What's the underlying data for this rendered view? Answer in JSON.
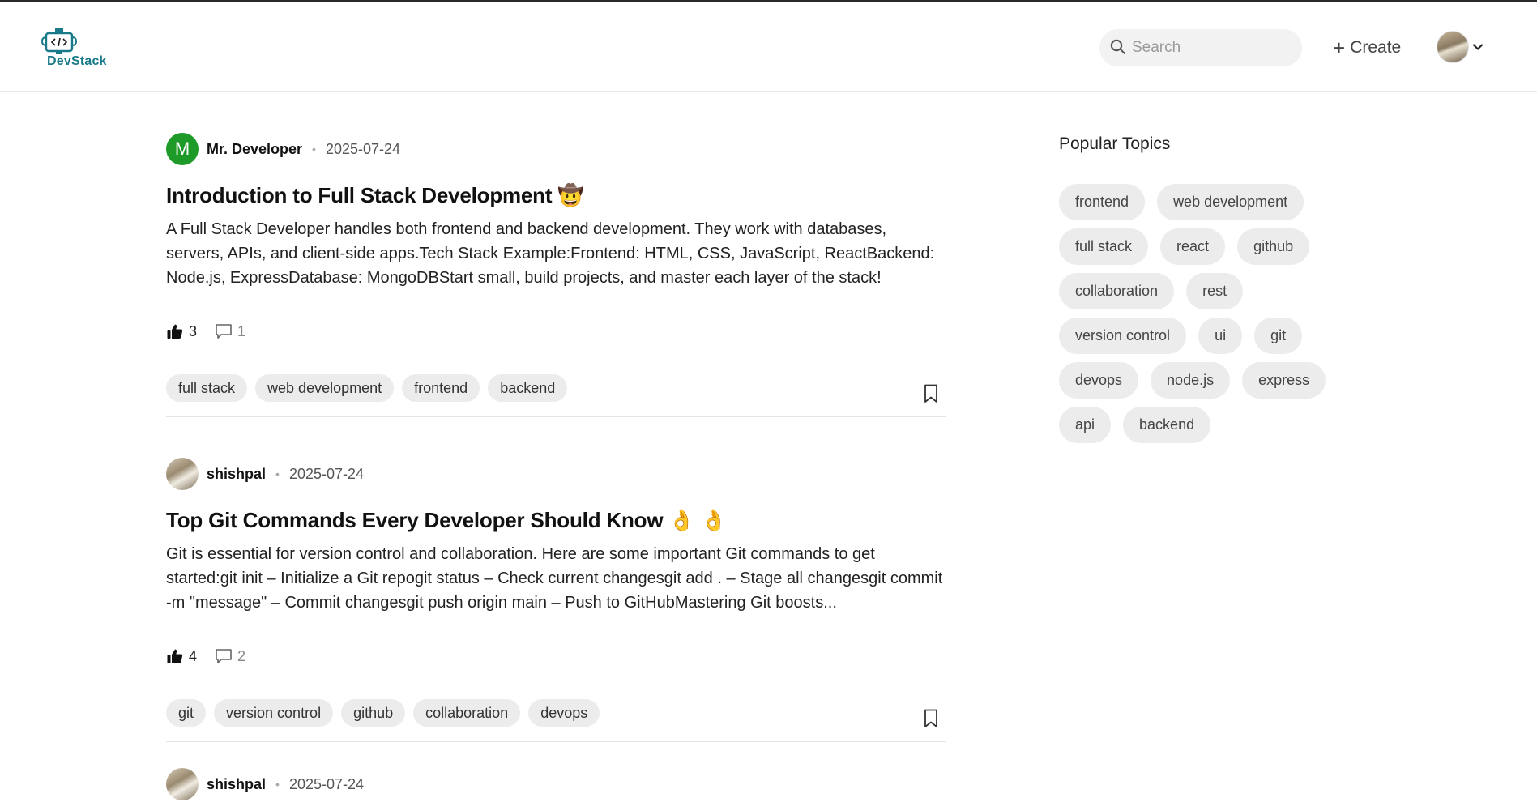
{
  "header": {
    "logo_text": "DevStack",
    "search_placeholder": "Search",
    "create_label": "Create"
  },
  "posts": [
    {
      "author_initial": "M",
      "author": "Mr. Developer",
      "date": "2025-07-24",
      "title": "Introduction to Full Stack Development 🤠",
      "excerpt": "A Full Stack Developer handles both frontend and backend development. They work with databases, servers, APIs, and client-side apps.Tech Stack Example:Frontend: HTML, CSS, JavaScript, ReactBackend: Node.js, ExpressDatabase: MongoDBStart small, build projects, and master each layer of the stack!",
      "likes": "3",
      "comments": "1",
      "tags": [
        "full stack",
        "web development",
        "frontend",
        "backend"
      ]
    },
    {
      "author": "shishpal",
      "date": "2025-07-24",
      "title": "Top Git Commands Every Developer Should Know 👌 👌",
      "excerpt": "Git is essential for version control and collaboration. Here are some important Git commands to get started:git init – Initialize a Git repogit status – Check current changesgit add . – Stage all changesgit commit -m \"message\" – Commit changesgit push origin main – Push to GitHubMastering Git boosts...",
      "likes": "4",
      "comments": "2",
      "tags": [
        "git",
        "version control",
        "github",
        "collaboration",
        "devops"
      ]
    },
    {
      "author": "shishpal",
      "date": "2025-07-24"
    }
  ],
  "sidebar": {
    "title": "Popular Topics",
    "topics": [
      "frontend",
      "web development",
      "full stack",
      "react",
      "github",
      "collaboration",
      "rest",
      "version control",
      "ui",
      "git",
      "devops",
      "node.js",
      "express",
      "api",
      "backend"
    ]
  },
  "colors": {
    "author_avatar_bg": "#1e9a28",
    "logo_text": "#1a7a8a",
    "tag_bg": "#ececec"
  }
}
